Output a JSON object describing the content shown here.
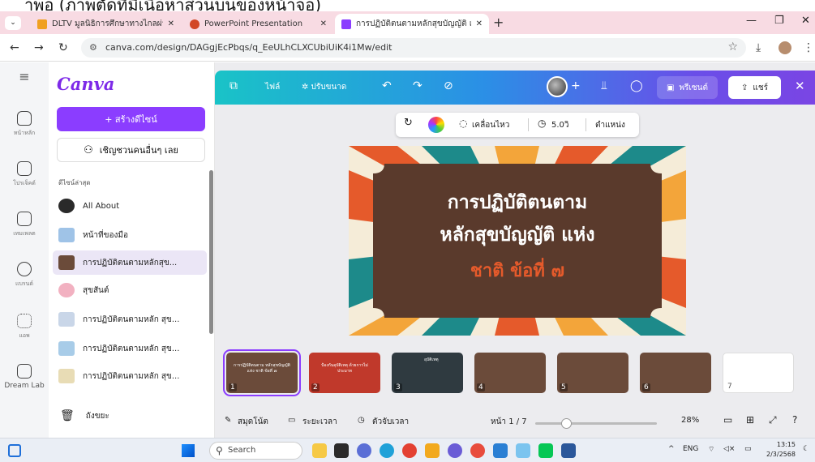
{
  "top_cutoff": "าพอ (ภาพตัดที่มีเนื้อหาส่วนบนของหน้าจอ)",
  "browser": {
    "tabs": [
      {
        "title": "DLTV มูลนิธิการศึกษาทางไกลผ่านดาวเทียม",
        "favicon_color": "#f0a020"
      },
      {
        "title": "PowerPoint Presentation",
        "favicon_color": "#d24726"
      },
      {
        "title": "การปฏิบัติตนตามหลักสุขบัญญัติ แห่ง",
        "favicon_color": "#8b3dff"
      }
    ],
    "url": "canva.com/design/DAGgjEcPbqs/q_EeULhCLXCUbiUiK4i1Mw/edit"
  },
  "rail": [
    {
      "label": "หน้าหลัก",
      "icon": "home-icon"
    },
    {
      "label": "โปรเจ็คต์",
      "icon": "folder-icon"
    },
    {
      "label": "เทมเพลต",
      "icon": "template-icon"
    },
    {
      "label": "แบรนด์",
      "icon": "brand-icon"
    },
    {
      "label": "แอพ",
      "icon": "apps-icon"
    },
    {
      "label": "Dream Lab",
      "icon": "dream-lab-icon"
    }
  ],
  "panel": {
    "logo": "Canva",
    "create_label": "+  สร้างดีไซน์",
    "invite_label": "เชิญชวนคนอื่นๆ เลย",
    "recent_title": "ดีไซน์ล่าสุด",
    "recent": [
      {
        "name": "All About",
        "thumb_color": "#2a2a2a"
      },
      {
        "name": "หน้าที่ของมือ",
        "thumb_color": "#9fc3e7"
      },
      {
        "name": "การปฏิบัติตนตามหลักสุข...",
        "thumb_color": "#6b4b3a"
      },
      {
        "name": "สุขสันต์",
        "thumb_color": "#f2b1c1"
      },
      {
        "name": "การปฏิบัติตนตามหลัก สุข...",
        "thumb_color": "#c9d6e8"
      },
      {
        "name": "การปฏิบัติตนตามหลัก สุข...",
        "thumb_color": "#a8cce8"
      },
      {
        "name": "การปฏิบัติตนตามหลัก สุข...",
        "thumb_color": "#e8dcb5"
      }
    ],
    "trash_label": "ถังขยะ"
  },
  "editor": {
    "file_label": "ไฟล์",
    "resize_label": "✲ ปรับขนาด",
    "present_label": "พรีเซนต์",
    "share_label": "แชร์",
    "floatbar": {
      "animate_label": "เคลื่อนไหว",
      "duration_label": "5.0วิ",
      "position_label": "ตำแหน่ง"
    },
    "slide": {
      "line1": "การปฏิบัติตนตาม",
      "line2": "หลักสุขบัญญัติ แห่ง",
      "line3": "ชาติ ข้อที่ ๗",
      "frame_color": "#5a3a2c",
      "accent_color": "#e55a2b"
    },
    "thumbnails": [
      {
        "num": "1",
        "caption": "การปฏิบัติตนตาม หลักสุขบัญญัติ แห่ง ชาติ ข้อที่ ๗",
        "color": "#5a3a2c"
      },
      {
        "num": "2",
        "caption": "ป้องกันอุบัติเหตุ ด้วยการไม่ประมาท",
        "color": "#c0392b"
      },
      {
        "num": "3",
        "caption": "อุบัติเหตุ",
        "color": "#2f3a40"
      },
      {
        "num": "4",
        "caption": "",
        "color": "#5a3a2c"
      },
      {
        "num": "5",
        "caption": "",
        "color": "#5a3a2c"
      },
      {
        "num": "6",
        "caption": "",
        "color": "#5a3a2c"
      },
      {
        "num": "7",
        "caption": "",
        "color": "#ffffff"
      }
    ],
    "bottom": {
      "notes_label": "สมุดโน้ต",
      "timer_label": "ระยะเวลา",
      "clock_label": "ตัวจับเวลา",
      "page_label": "หน้า 1 / 7",
      "zoom": "28%"
    }
  },
  "taskbar": {
    "search_placeholder": "Search",
    "lang": "ENG",
    "time": "13:15",
    "date": "2/3/2568"
  }
}
